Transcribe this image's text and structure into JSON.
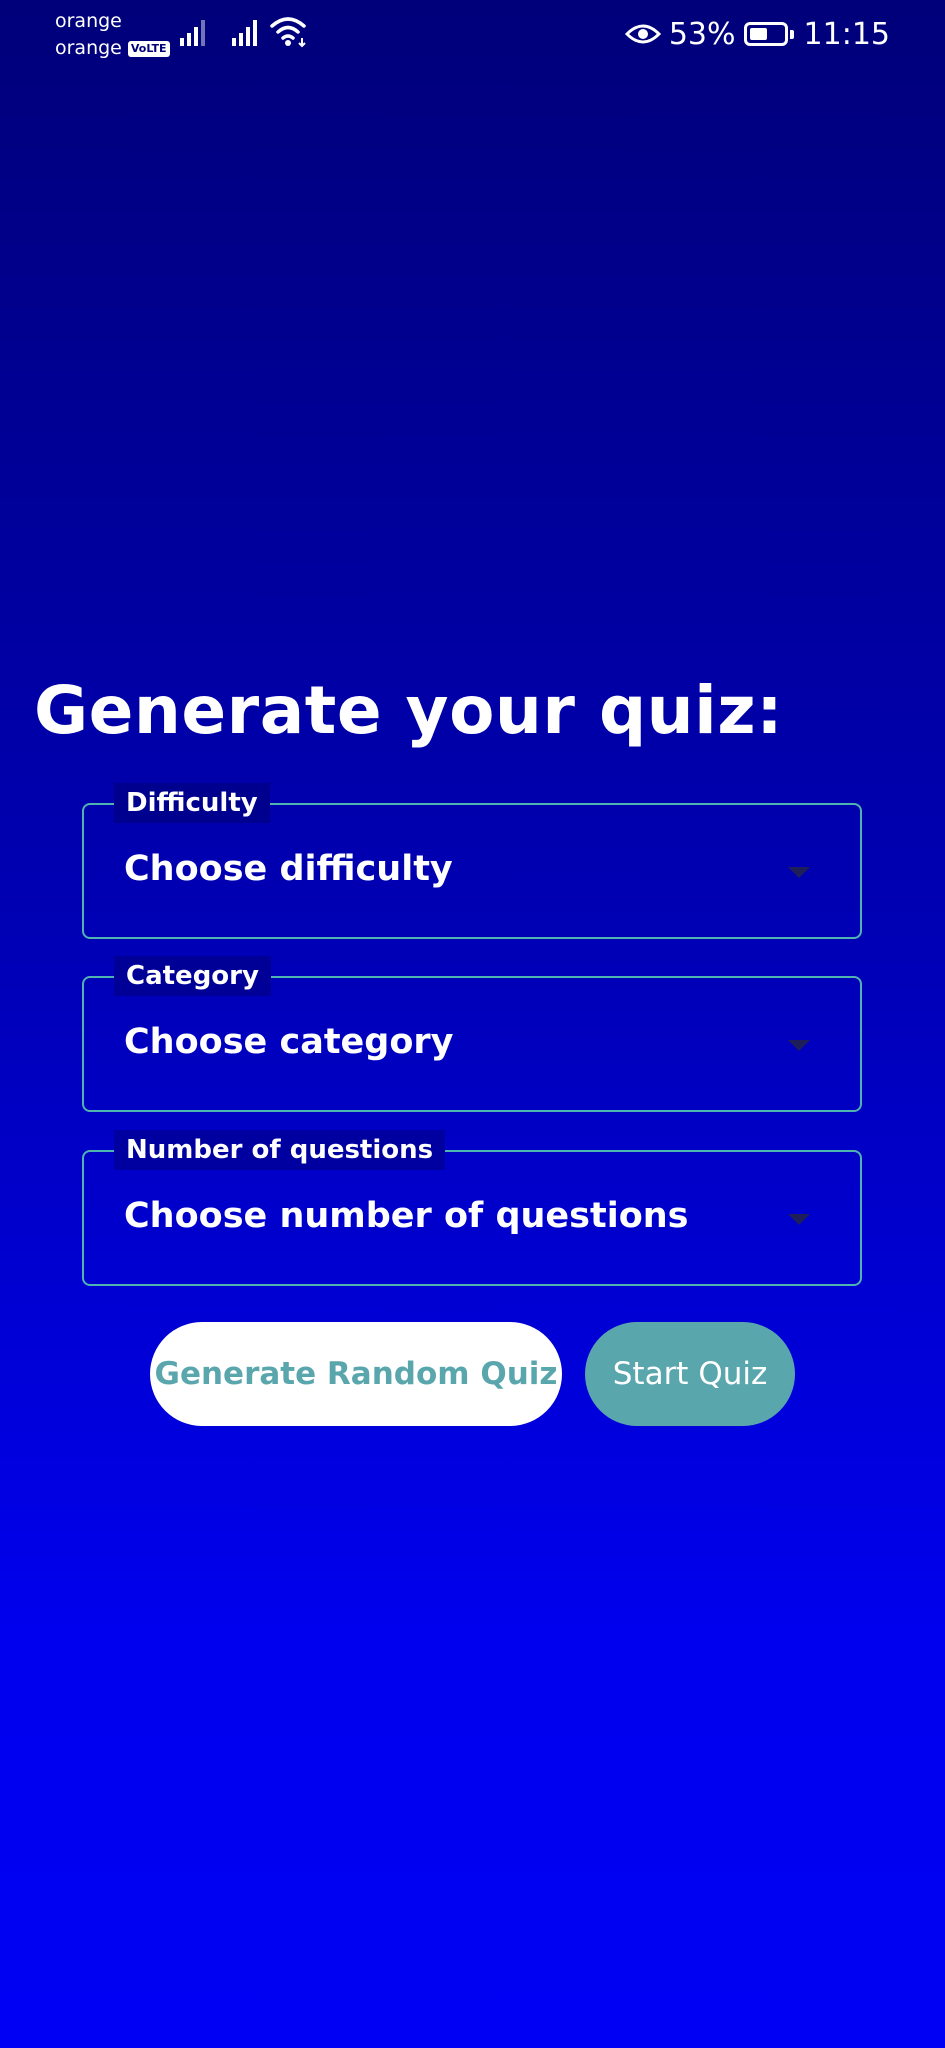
{
  "status_bar": {
    "carrier_1": "orange",
    "carrier_2": "orange",
    "volte_badge": "VoLTE",
    "battery_percent": "53%",
    "battery_level": 0.53,
    "time": "11:15",
    "icons": [
      "signal-icon",
      "signal-icon",
      "wifi-icon",
      "eye-icon",
      "battery-icon"
    ]
  },
  "main": {
    "title": "Generate your quiz:",
    "fields": [
      {
        "label": "Difficulty",
        "value": "Choose difficulty"
      },
      {
        "label": "Category",
        "value": "Choose category"
      },
      {
        "label": "Number of questions",
        "value": "Choose number of questions"
      }
    ],
    "buttons": {
      "random_quiz": "Generate Random Quiz",
      "start_quiz": "Start Quiz"
    }
  },
  "colors": {
    "background_top": "#00007a",
    "background_bottom": "#0000f4",
    "accent_teal": "#5aa6ad",
    "field_border": "#4fb3b0"
  }
}
